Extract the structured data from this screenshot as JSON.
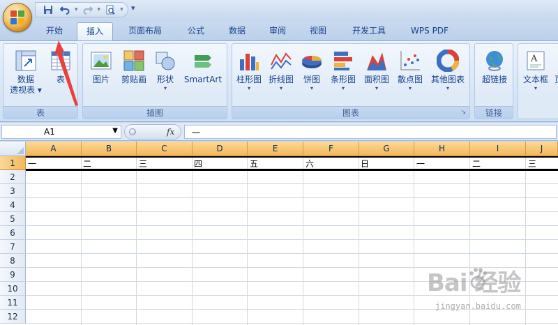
{
  "quick_access": {
    "save_icon": "save-icon",
    "undo_icon": "undo-icon",
    "redo_icon": "redo-icon",
    "print_preview_icon": "print-preview-icon",
    "customize_glyph": "▾"
  },
  "tabs": [
    {
      "label": "开始",
      "active": false
    },
    {
      "label": "插入",
      "active": true
    },
    {
      "label": "页面布局",
      "active": false
    },
    {
      "label": "公式",
      "active": false
    },
    {
      "label": "数据",
      "active": false
    },
    {
      "label": "审阅",
      "active": false
    },
    {
      "label": "视图",
      "active": false
    },
    {
      "label": "开发工具",
      "active": false
    },
    {
      "label": "WPS PDF",
      "active": false
    }
  ],
  "ribbon": {
    "groups": {
      "table": "表",
      "illustrations": "插图",
      "charts": "图表",
      "links": "链接"
    },
    "buttons": {
      "pivot_line1": "数据",
      "pivot_line2": "透视表 ▾",
      "table": "表",
      "picture": "图片",
      "clipart": "剪贴画",
      "shapes": "形状",
      "smartart": "SmartArt",
      "column": "柱形图",
      "line": "折线图",
      "pie": "饼图",
      "bar": "条形图",
      "area": "面积图",
      "scatter": "散点图",
      "other_charts": "其他图表",
      "hyperlink": "超链接",
      "textbox": "文本框",
      "cutoff": "页"
    }
  },
  "formula_bar": {
    "name_box": "A1",
    "fx": "fx",
    "formula": "一"
  },
  "sheet": {
    "columns": [
      "A",
      "B",
      "C",
      "D",
      "E",
      "F",
      "G",
      "H",
      "I",
      "J"
    ],
    "rows": [
      "1",
      "2",
      "3",
      "4",
      "5",
      "6",
      "7",
      "8",
      "9",
      "10",
      "11",
      "12"
    ],
    "row1": [
      "一",
      "二",
      "三",
      "四",
      "五",
      "六",
      "日",
      "一",
      "二",
      "三"
    ]
  },
  "watermark": {
    "brand": "Bai  经验",
    "url": "jingyan.baidu.com"
  },
  "colors": {
    "annotation_arrow": "#e8403a",
    "selected_header": "#f4b75a",
    "ribbon_text": "#15428b"
  }
}
